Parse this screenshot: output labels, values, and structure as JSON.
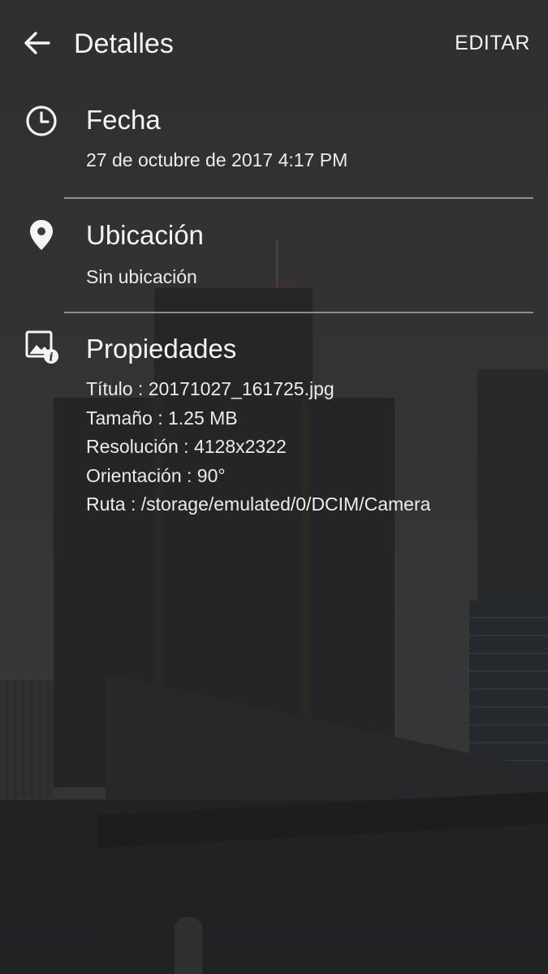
{
  "header": {
    "title": "Detalles",
    "edit_label": "EDITAR"
  },
  "sections": {
    "date": {
      "heading": "Fecha",
      "value": "27 de octubre de 2017 4:17 PM",
      "icon": "clock-icon"
    },
    "location": {
      "heading": "Ubicación",
      "value": "Sin ubicación",
      "icon": "location-pin-icon"
    },
    "properties": {
      "heading": "Propiedades",
      "icon": "image-info-icon",
      "lines": [
        "Título : 20171027_161725.jpg",
        "Tamaño : 1.25 MB",
        "Resolución : 4128x2322",
        "Orientación : 90°",
        "Ruta : /storage/emulated/0/DCIM/Camera"
      ]
    }
  },
  "colors": {
    "text": "#f4f4f4",
    "divider": "#8e8e90",
    "background": "#3b3b3c"
  }
}
